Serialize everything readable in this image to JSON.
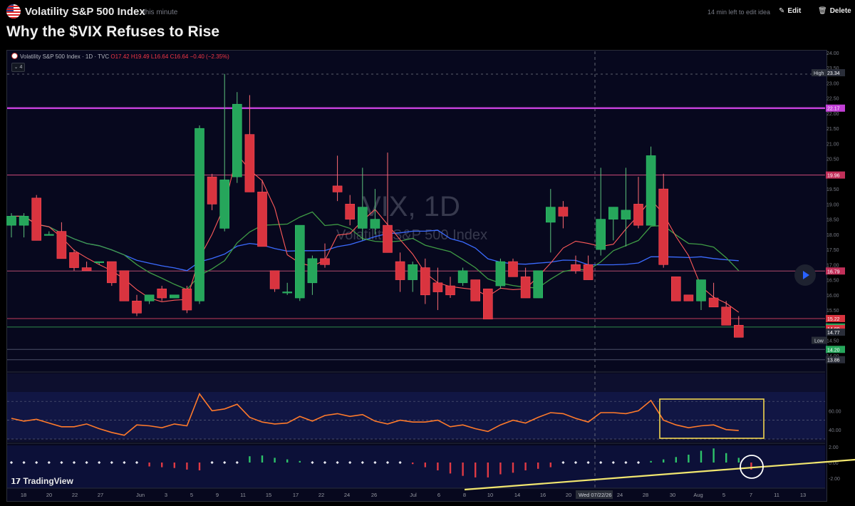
{
  "header": {
    "symbol_name": "Volatility S&P 500 Index",
    "timestamp": "this minute",
    "edit_notice": "14 min left to edit idea",
    "edit_label": "Edit",
    "delete_label": "Delete",
    "idea_title": "Why the $VIX Refuses to Rise"
  },
  "chart_legend": {
    "symbol": "Volatility S&P 500 Index · 1D · TVC",
    "open": "O17.42",
    "high": "H19.49",
    "low": "L16.64",
    "close": "C16.64",
    "change": "−0.40 (−2.35%)",
    "collapse_count": "4"
  },
  "watermark": {
    "ticker": "VIX, 1D",
    "name": "Volatility S&P 500 Index"
  },
  "branding": "TradingView",
  "colors": {
    "up": "#26a65b",
    "down": "#d9343f",
    "accent": "#2962ff",
    "resistance": "#c23fd6",
    "trendline": "#f1e66f",
    "box": "#f1d54f",
    "rsi": "#ff7a2a",
    "ma_blue": "#3b6bff",
    "ma_green": "#3f9b45",
    "ma_red": "#ff5a5a"
  },
  "chart_data": [
    {
      "type": "candlestick",
      "series": [
        {
          "name": "Volatility S&P 500 Index",
          "values": [
            {
              "o": 18.3,
              "h": 18.7,
              "l": 17.9,
              "c": 18.6
            },
            {
              "o": 18.3,
              "h": 18.7,
              "l": 17.9,
              "c": 18.6
            },
            {
              "o": 19.2,
              "h": 19.3,
              "l": 17.8,
              "c": 17.8
            },
            {
              "o": 18.0,
              "h": 18.1,
              "l": 18.0,
              "c": 18.0
            },
            {
              "o": 18.1,
              "h": 18.4,
              "l": 17.2,
              "c": 17.2
            },
            {
              "o": 17.4,
              "h": 17.5,
              "l": 16.8,
              "c": 16.9
            },
            {
              "o": 16.9,
              "h": 17.1,
              "l": 16.8,
              "c": 16.8
            },
            {
              "o": 17.1,
              "h": 17.1,
              "l": 17.0,
              "c": 17.1
            },
            {
              "o": 17.1,
              "h": 17.1,
              "l": 16.3,
              "c": 16.4
            },
            {
              "o": 16.8,
              "h": 16.8,
              "l": 15.8,
              "c": 15.8
            },
            {
              "o": 15.8,
              "h": 16.0,
              "l": 15.3,
              "c": 15.4
            },
            {
              "o": 15.8,
              "h": 16.0,
              "l": 15.7,
              "c": 16.0
            },
            {
              "o": 16.2,
              "h": 16.3,
              "l": 15.8,
              "c": 15.9
            },
            {
              "o": 15.9,
              "h": 16.0,
              "l": 15.9,
              "c": 16.0
            },
            {
              "o": 16.2,
              "h": 16.3,
              "l": 15.4,
              "c": 15.5
            },
            {
              "o": 15.8,
              "h": 21.6,
              "l": 15.7,
              "c": 21.5
            },
            {
              "o": 19.9,
              "h": 20.0,
              "l": 18.8,
              "c": 19.0
            },
            {
              "o": 18.2,
              "h": 23.3,
              "l": 18.1,
              "c": 19.8
            },
            {
              "o": 19.9,
              "h": 22.7,
              "l": 19.7,
              "c": 22.3
            },
            {
              "o": 21.3,
              "h": 22.6,
              "l": 19.4,
              "c": 19.4
            },
            {
              "o": 19.4,
              "h": 19.8,
              "l": 17.6,
              "c": 17.6
            },
            {
              "o": 16.8,
              "h": 16.8,
              "l": 16.1,
              "c": 16.2
            },
            {
              "o": 16.1,
              "h": 16.4,
              "l": 16.0,
              "c": 16.1
            },
            {
              "o": 15.9,
              "h": 18.2,
              "l": 15.8,
              "c": 18.3
            },
            {
              "o": 16.4,
              "h": 17.3,
              "l": 16.0,
              "c": 17.2
            },
            {
              "o": 17.2,
              "h": 17.7,
              "l": 16.9,
              "c": 17.0
            },
            {
              "o": 19.6,
              "h": 20.6,
              "l": 19.1,
              "c": 19.4
            },
            {
              "o": 19.0,
              "h": 19.3,
              "l": 18.3,
              "c": 18.5
            },
            {
              "o": 18.2,
              "h": 20.2,
              "l": 17.8,
              "c": 18.9
            },
            {
              "o": 18.2,
              "h": 19.5,
              "l": 18.0,
              "c": 18.5
            },
            {
              "o": 18.3,
              "h": 20.7,
              "l": 17.4,
              "c": 17.4
            },
            {
              "o": 17.1,
              "h": 17.4,
              "l": 16.1,
              "c": 16.5
            },
            {
              "o": 16.5,
              "h": 17.1,
              "l": 16.1,
              "c": 17.0
            },
            {
              "o": 16.9,
              "h": 17.2,
              "l": 15.7,
              "c": 16.0
            },
            {
              "o": 16.4,
              "h": 16.9,
              "l": 15.5,
              "c": 16.1
            },
            {
              "o": 16.3,
              "h": 16.6,
              "l": 15.9,
              "c": 16.0
            },
            {
              "o": 16.4,
              "h": 16.9,
              "l": 16.3,
              "c": 16.8
            },
            {
              "o": 16.5,
              "h": 16.5,
              "l": 15.8,
              "c": 15.8
            },
            {
              "o": 16.2,
              "h": 16.2,
              "l": 15.2,
              "c": 15.2
            },
            {
              "o": 16.3,
              "h": 17.2,
              "l": 16.2,
              "c": 17.1
            },
            {
              "o": 17.1,
              "h": 17.2,
              "l": 16.6,
              "c": 16.6
            },
            {
              "o": 16.6,
              "h": 16.9,
              "l": 15.9,
              "c": 15.9
            },
            {
              "o": 15.9,
              "h": 16.8,
              "l": 15.9,
              "c": 16.8
            },
            {
              "o": 18.4,
              "h": 19.5,
              "l": 17.4,
              "c": 18.9
            },
            {
              "o": 18.9,
              "h": 19.1,
              "l": 18.2,
              "c": 18.6
            },
            {
              "o": 17.0,
              "h": 17.3,
              "l": 16.7,
              "c": 16.8
            },
            {
              "o": 17.0,
              "h": 17.3,
              "l": 16.5,
              "c": 16.5
            },
            {
              "o": 17.5,
              "h": 20.2,
              "l": 17.3,
              "c": 18.5
            },
            {
              "o": 18.5,
              "h": 18.9,
              "l": 17.8,
              "c": 18.9
            },
            {
              "o": 18.5,
              "h": 20.2,
              "l": 17.6,
              "c": 18.8
            },
            {
              "o": 19.0,
              "h": 19.9,
              "l": 18.2,
              "c": 18.3
            },
            {
              "o": 18.3,
              "h": 20.9,
              "l": 18.3,
              "c": 20.6
            },
            {
              "o": 19.5,
              "h": 20.0,
              "l": 16.9,
              "c": 17.0
            },
            {
              "o": 16.6,
              "h": 16.6,
              "l": 15.8,
              "c": 15.8
            },
            {
              "o": 16.0,
              "h": 16.0,
              "l": 15.8,
              "c": 15.8
            },
            {
              "o": 15.8,
              "h": 16.1,
              "l": 15.5,
              "c": 16.5
            },
            {
              "o": 15.9,
              "h": 16.4,
              "l": 15.6,
              "c": 15.6
            },
            {
              "o": 15.6,
              "h": 15.8,
              "l": 15.2,
              "c": 15.0
            },
            {
              "o": 15.0,
              "h": 15.3,
              "l": 14.8,
              "c": 14.6
            }
          ]
        }
      ],
      "ylim": [
        13.5,
        24.0
      ],
      "y_ticks": [
        "24.00",
        "23.50",
        "23.00",
        "22.50",
        "22.00",
        "21.50",
        "21.00",
        "20.50",
        "20.00",
        "19.50",
        "19.00",
        "18.50",
        "18.00",
        "17.50",
        "17.00",
        "16.50",
        "16.00",
        "15.50",
        "15.00",
        "14.50",
        "14.00"
      ],
      "price_labels": [
        {
          "text": "High",
          "value": "23.34"
        },
        {
          "value": "22.17"
        },
        {
          "value": "19.96"
        },
        {
          "value": "16.79"
        },
        {
          "value": "15.22"
        },
        {
          "value": "14.94"
        },
        {
          "value": "14.89"
        },
        {
          "value": "14.77"
        },
        {
          "text": "Low"
        },
        {
          "value": "14.20"
        },
        {
          "value": "13.86"
        }
      ],
      "horizontal_levels": [
        22.17,
        19.96,
        16.79,
        15.22,
        14.94,
        14.2,
        13.86
      ],
      "x_labels": [
        "18",
        "20",
        "22",
        "27",
        "Jun",
        "3",
        "5",
        "9",
        "11",
        "15",
        "17",
        "22",
        "24",
        "26",
        "Jul",
        "6",
        "8",
        "10",
        "14",
        "16",
        "20",
        "Wed 07/22/26",
        "24",
        "28",
        "30",
        "Aug",
        "5",
        "7",
        "11",
        "13"
      ]
    },
    {
      "type": "line",
      "name": "RSI",
      "y_ticks": [
        "60.00",
        "40.00"
      ],
      "values": [
        52,
        49,
        51,
        47,
        43,
        43,
        46,
        41,
        37,
        34,
        45,
        44,
        42,
        46,
        44,
        78,
        60,
        62,
        67,
        53,
        48,
        46,
        47,
        54,
        49,
        55,
        57,
        54,
        56,
        49,
        46,
        50,
        48,
        48,
        50,
        43,
        45,
        41,
        38,
        45,
        50,
        47,
        53,
        58,
        57,
        52,
        48,
        58,
        58,
        57,
        60,
        71,
        50,
        45,
        42,
        44,
        45,
        40,
        39
      ]
    },
    {
      "type": "bar",
      "name": "Histogram",
      "y_ticks": [
        "2.00",
        "0.00",
        "-2.00"
      ],
      "values": [
        0,
        0,
        0,
        0,
        0,
        0,
        0,
        0,
        0,
        0,
        0,
        -0.5,
        -0.6,
        -0.7,
        -0.9,
        -1.0,
        0,
        0,
        0,
        0.8,
        0.9,
        0.6,
        0.4,
        0.2,
        0,
        0,
        0,
        0,
        0,
        0,
        0,
        0,
        -0.2,
        -0.6,
        -1.0,
        -1.4,
        -1.7,
        -1.9,
        -1.9,
        -1.5,
        -1.3,
        -1.0,
        -0.8,
        -0.6,
        0,
        0,
        0,
        0,
        0,
        0,
        0,
        0.2,
        0.4,
        0.7,
        1.0,
        1.5,
        1.8,
        1.2,
        0.6,
        -0.9
      ]
    }
  ]
}
